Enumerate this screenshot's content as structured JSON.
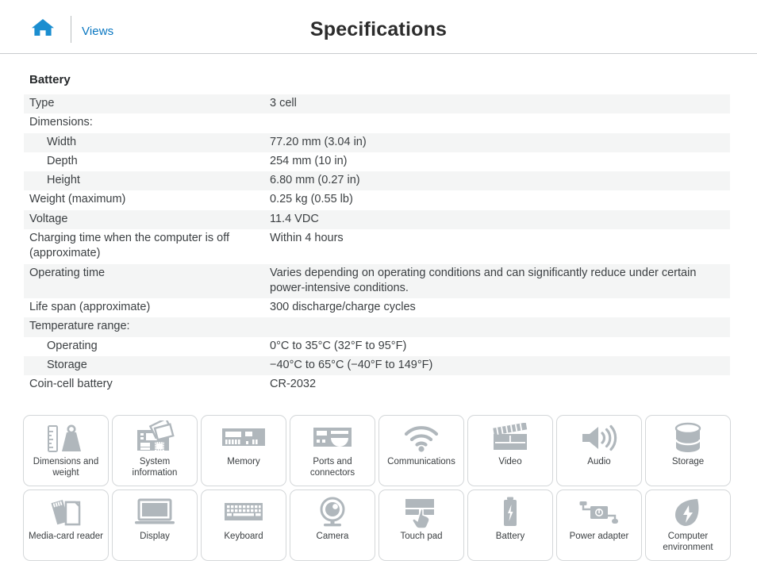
{
  "header": {
    "home_icon": "home-icon",
    "views_label": "Views",
    "title": "Specifications"
  },
  "section": {
    "title": "Battery",
    "rows": [
      {
        "label": "Type",
        "value": "3 cell",
        "indent": false,
        "stripe": true
      },
      {
        "label": "Dimensions:",
        "value": "",
        "indent": false,
        "stripe": false
      },
      {
        "label": "Width",
        "value": "77.20 mm (3.04 in)",
        "indent": true,
        "stripe": true
      },
      {
        "label": "Depth",
        "value": "254 mm (10 in)",
        "indent": true,
        "stripe": false
      },
      {
        "label": "Height",
        "value": "6.80 mm (0.27 in)",
        "indent": true,
        "stripe": true
      },
      {
        "label": "Weight (maximum)",
        "value": "0.25 kg (0.55 lb)",
        "indent": false,
        "stripe": false
      },
      {
        "label": "Voltage",
        "value": "11.4 VDC",
        "indent": false,
        "stripe": true
      },
      {
        "label": "Charging time when the computer is off (approximate)",
        "value": "Within 4 hours",
        "indent": false,
        "stripe": false
      },
      {
        "label": "Operating time",
        "value": "Varies depending on operating conditions and can significantly reduce under certain power-intensive conditions.",
        "indent": false,
        "stripe": true
      },
      {
        "label": "Life span (approximate)",
        "value": "300 discharge/charge cycles",
        "indent": false,
        "stripe": false
      },
      {
        "label": "Temperature range:",
        "value": "",
        "indent": false,
        "stripe": true
      },
      {
        "label": "Operating",
        "value": "0°C to 35°C (32°F to 95°F)",
        "indent": true,
        "stripe": false
      },
      {
        "label": "Storage",
        "value": "−40°C to 65°C (−40°F to 149°F)",
        "indent": true,
        "stripe": true
      },
      {
        "label": "Coin-cell battery",
        "value": "CR-2032",
        "indent": false,
        "stripe": false
      }
    ]
  },
  "tiles": [
    {
      "label": "Dimensions and weight",
      "icon": "ruler-and-weight-icon"
    },
    {
      "label": "System information",
      "icon": "circuit-board-icon"
    },
    {
      "label": "Memory",
      "icon": "memory-module-icon"
    },
    {
      "label": "Ports and connectors",
      "icon": "ports-icon"
    },
    {
      "label": "Communications",
      "icon": "wifi-icon"
    },
    {
      "label": "Video",
      "icon": "clapperboard-icon"
    },
    {
      "label": "Audio",
      "icon": "speaker-icon"
    },
    {
      "label": "Storage",
      "icon": "drive-cylinder-icon"
    },
    {
      "label": "Media-card reader",
      "icon": "media-card-icon"
    },
    {
      "label": "Display",
      "icon": "laptop-display-icon"
    },
    {
      "label": "Keyboard",
      "icon": "keyboard-icon"
    },
    {
      "label": "Camera",
      "icon": "webcam-icon"
    },
    {
      "label": "Touch pad",
      "icon": "touchpad-icon"
    },
    {
      "label": "Battery",
      "icon": "battery-icon"
    },
    {
      "label": "Power adapter",
      "icon": "power-adapter-icon"
    },
    {
      "label": "Computer environment",
      "icon": "leaf-icon"
    }
  ],
  "colors": {
    "link": "#0a77c1",
    "home_icon": "#1b8ed0",
    "tile_icon": "#b0b7bc",
    "row_stripe": "#f4f5f5",
    "text": "#3c4043"
  }
}
